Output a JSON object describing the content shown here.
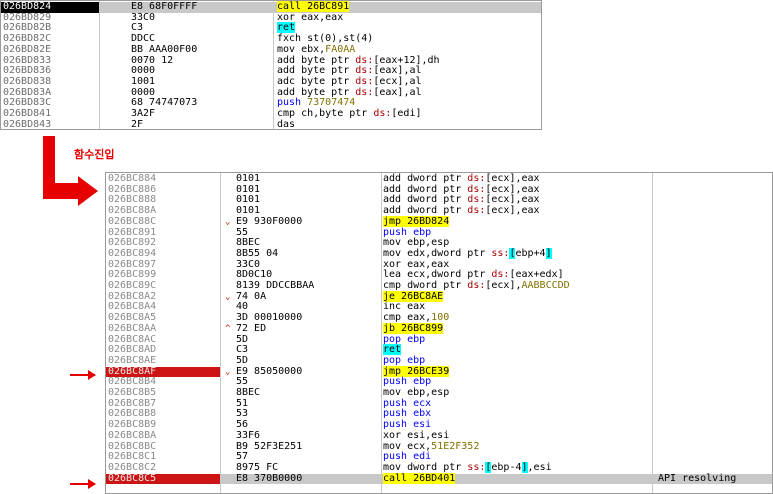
{
  "top_panel": {
    "rows": [
      {
        "addr": "026BD824",
        "bytes": "E8 68F0FFFF",
        "mark": "",
        "dis": [
          {
            "t": "call 26BC891",
            "c": "t-call"
          }
        ],
        "sel": true
      },
      {
        "addr": "026BD829",
        "bytes": "33C0",
        "mark": "",
        "dis": [
          {
            "t": "xor eax,eax"
          }
        ]
      },
      {
        "addr": "026BD82B",
        "bytes": "C3",
        "mark": "",
        "dis": [
          {
            "t": "ret",
            "c": "t-ret"
          }
        ]
      },
      {
        "addr": "026BD82C",
        "bytes": "DDCC",
        "mark": "",
        "dis": [
          {
            "t": "fxch st(0),st(4)"
          }
        ]
      },
      {
        "addr": "026BD82E",
        "bytes": "BB AAA00F00",
        "mark": "",
        "dis": [
          {
            "t": "mov ebx,"
          },
          {
            "t": "FA0AA",
            "c": "num"
          }
        ]
      },
      {
        "addr": "026BD833",
        "bytes": "0070 12",
        "mark": "",
        "dis": [
          {
            "t": "add byte ptr "
          },
          {
            "t": "ds:",
            "c": "seg"
          },
          {
            "t": "[eax+12],dh"
          }
        ]
      },
      {
        "addr": "026BD836",
        "bytes": "0000",
        "mark": "",
        "dis": [
          {
            "t": "add byte ptr "
          },
          {
            "t": "ds:",
            "c": "seg"
          },
          {
            "t": "[eax],al"
          }
        ]
      },
      {
        "addr": "026BD838",
        "bytes": "1001",
        "mark": "",
        "dis": [
          {
            "t": "adc byte ptr "
          },
          {
            "t": "ds:",
            "c": "seg"
          },
          {
            "t": "[ecx],al"
          }
        ]
      },
      {
        "addr": "026BD83A",
        "bytes": "0000",
        "mark": "",
        "dis": [
          {
            "t": "add byte ptr "
          },
          {
            "t": "ds:",
            "c": "seg"
          },
          {
            "t": "[eax],al"
          }
        ]
      },
      {
        "addr": "026BD83C",
        "bytes": "68 74747073",
        "mark": "",
        "dis": [
          {
            "t": "push ",
            "c": "t-pp"
          },
          {
            "t": "73707474",
            "c": "num"
          }
        ]
      },
      {
        "addr": "026BD841",
        "bytes": "3A2F",
        "mark": "",
        "dis": [
          {
            "t": "cmp ch,byte ptr "
          },
          {
            "t": "ds:",
            "c": "seg"
          },
          {
            "t": "[edi]"
          }
        ]
      },
      {
        "addr": "026BD843",
        "bytes": "2F",
        "mark": "",
        "dis": [
          {
            "t": "das"
          }
        ]
      }
    ]
  },
  "label": "함수진입",
  "bottom_panel": {
    "rows": [
      {
        "addr": "026BC884",
        "bytes": "0101",
        "mark": "",
        "dis": [
          {
            "t": "add dword ptr "
          },
          {
            "t": "ds:",
            "c": "seg"
          },
          {
            "t": "[ecx],eax"
          }
        ]
      },
      {
        "addr": "026BC886",
        "bytes": "0101",
        "mark": "",
        "dis": [
          {
            "t": "add dword ptr "
          },
          {
            "t": "ds:",
            "c": "seg"
          },
          {
            "t": "[ecx],eax"
          }
        ]
      },
      {
        "addr": "026BC888",
        "bytes": "0101",
        "mark": "",
        "dis": [
          {
            "t": "add dword ptr "
          },
          {
            "t": "ds:",
            "c": "seg"
          },
          {
            "t": "[ecx],eax"
          }
        ]
      },
      {
        "addr": "026BC88A",
        "bytes": "0101",
        "mark": "",
        "dis": [
          {
            "t": "add dword ptr "
          },
          {
            "t": "ds:",
            "c": "seg"
          },
          {
            "t": "[ecx],eax"
          }
        ]
      },
      {
        "addr": "026BC88C",
        "bytes": "E9 930F0000",
        "mark": "⌄",
        "dis": [
          {
            "t": "jmp 26BD824",
            "c": "t-jmp"
          }
        ]
      },
      {
        "addr": "026BC891",
        "bytes": "55",
        "mark": "",
        "dis": [
          {
            "t": "push ebp",
            "c": "t-pp"
          }
        ]
      },
      {
        "addr": "026BC892",
        "bytes": "8BEC",
        "mark": "",
        "dis": [
          {
            "t": "mov ebp,esp"
          }
        ]
      },
      {
        "addr": "026BC894",
        "bytes": "8B55 04",
        "mark": "",
        "dis": [
          {
            "t": "mov edx,dword ptr "
          },
          {
            "t": "ss:",
            "c": "seg"
          },
          {
            "t": "[",
            "c": "br"
          },
          {
            "t": "ebp+4"
          },
          {
            "t": "]",
            "c": "br"
          }
        ]
      },
      {
        "addr": "026BC897",
        "bytes": "33C0",
        "mark": "",
        "dis": [
          {
            "t": "xor eax,eax"
          }
        ]
      },
      {
        "addr": "026BC899",
        "bytes": "8D0C10",
        "mark": "",
        "dis": [
          {
            "t": "lea ecx,dword ptr "
          },
          {
            "t": "ds:",
            "c": "seg"
          },
          {
            "t": "[eax+edx]"
          }
        ]
      },
      {
        "addr": "026BC89C",
        "bytes": "8139 DDCCBBAA",
        "mark": "",
        "dis": [
          {
            "t": "cmp dword ptr "
          },
          {
            "t": "ds:",
            "c": "seg"
          },
          {
            "t": "[ecx],"
          },
          {
            "t": "AABBCCDD",
            "c": "num"
          }
        ]
      },
      {
        "addr": "026BC8A2",
        "bytes": "74 0A",
        "mark": "⌄",
        "dis": [
          {
            "t": "je 26BC8AE",
            "c": "t-jmp"
          }
        ]
      },
      {
        "addr": "026BC8A4",
        "bytes": "40",
        "mark": "",
        "dis": [
          {
            "t": "inc eax"
          }
        ]
      },
      {
        "addr": "026BC8A5",
        "bytes": "3D 00010000",
        "mark": "",
        "dis": [
          {
            "t": "cmp eax,"
          },
          {
            "t": "100",
            "c": "num"
          }
        ]
      },
      {
        "addr": "026BC8AA",
        "bytes": "72 ED",
        "mark": "^",
        "dis": [
          {
            "t": "jb 26BC899",
            "c": "t-jmp"
          }
        ]
      },
      {
        "addr": "026BC8AC",
        "bytes": "5D",
        "mark": "",
        "dis": [
          {
            "t": "pop ebp",
            "c": "t-pp"
          }
        ]
      },
      {
        "addr": "026BC8AD",
        "bytes": "C3",
        "mark": "",
        "dis": [
          {
            "t": "ret",
            "c": "t-ret"
          }
        ]
      },
      {
        "addr": "026BC8AE",
        "bytes": "5D",
        "mark": "",
        "dis": [
          {
            "t": "pop ebp",
            "c": "t-pp"
          }
        ]
      },
      {
        "addr": "026BC8AF",
        "bytes": "E9 85050000",
        "mark": "⌄",
        "dis": [
          {
            "t": "jmp 26BCE39",
            "c": "t-jmp"
          }
        ],
        "hl": true
      },
      {
        "addr": "026BC8B4",
        "bytes": "55",
        "mark": "",
        "dis": [
          {
            "t": "push ebp",
            "c": "t-pp"
          }
        ]
      },
      {
        "addr": "026BC8B5",
        "bytes": "8BEC",
        "mark": "",
        "dis": [
          {
            "t": "mov ebp,esp"
          }
        ]
      },
      {
        "addr": "026BC8B7",
        "bytes": "51",
        "mark": "",
        "dis": [
          {
            "t": "push ecx",
            "c": "t-pp"
          }
        ]
      },
      {
        "addr": "026BC8B8",
        "bytes": "53",
        "mark": "",
        "dis": [
          {
            "t": "push ebx",
            "c": "t-pp"
          }
        ]
      },
      {
        "addr": "026BC8B9",
        "bytes": "56",
        "mark": "",
        "dis": [
          {
            "t": "push esi",
            "c": "t-pp"
          }
        ]
      },
      {
        "addr": "026BC8BA",
        "bytes": "33F6",
        "mark": "",
        "dis": [
          {
            "t": "xor esi,esi"
          }
        ]
      },
      {
        "addr": "026BC8BC",
        "bytes": "B9 52F3E251",
        "mark": "",
        "dis": [
          {
            "t": "mov ecx,"
          },
          {
            "t": "51E2F352",
            "c": "num"
          }
        ]
      },
      {
        "addr": "026BC8C1",
        "bytes": "57",
        "mark": "",
        "dis": [
          {
            "t": "push edi",
            "c": "t-pp"
          }
        ]
      },
      {
        "addr": "026BC8C2",
        "bytes": "8975 FC",
        "mark": "",
        "dis": [
          {
            "t": "mov dword ptr "
          },
          {
            "t": "ss:",
            "c": "seg"
          },
          {
            "t": "[",
            "c": "br"
          },
          {
            "t": "ebp-4"
          },
          {
            "t": "]",
            "c": "br"
          },
          {
            "t": ",esi"
          }
        ]
      },
      {
        "addr": "026BC8C5",
        "bytes": "E8 370B0000",
        "mark": "",
        "dis": [
          {
            "t": "call 26BD401",
            "c": "t-call"
          }
        ],
        "hl": true,
        "sel": true,
        "comment": "API resolving"
      }
    ]
  },
  "colors": {
    "arrow": "#e60000",
    "highlight": "#cc1414",
    "call": "#ffff00",
    "ret": "#00ffff"
  }
}
